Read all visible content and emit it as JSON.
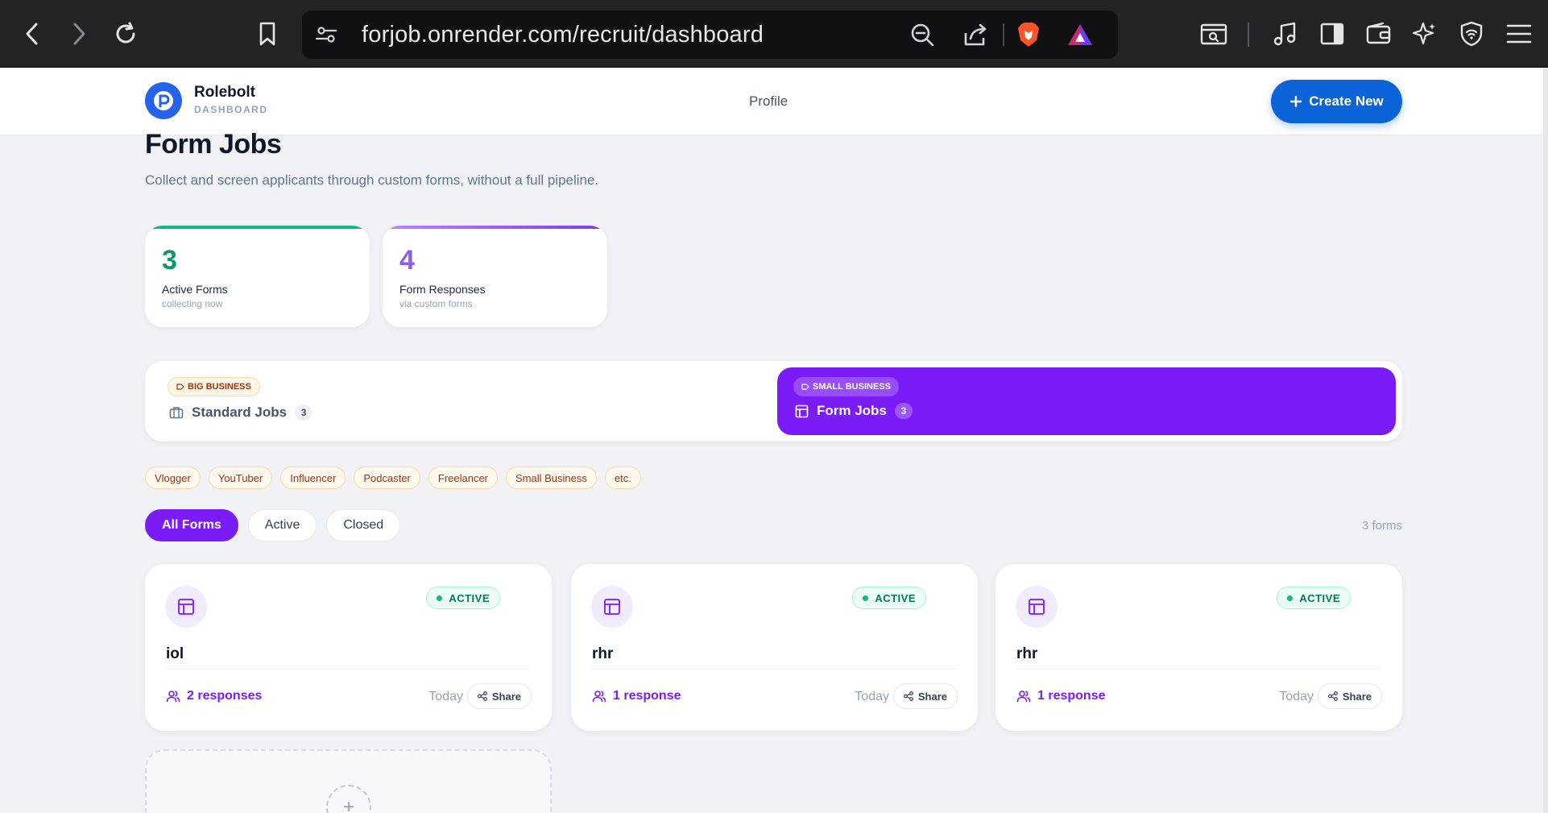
{
  "browser": {
    "url": "forjob.onrender.com/recruit/dashboard"
  },
  "header": {
    "brand_name": "Rolebolt",
    "brand_sub": "DASHBOARD",
    "nav_profile": "Profile",
    "create_label": "Create New"
  },
  "page": {
    "title": "Form Jobs",
    "subtitle": "Collect and screen applicants through custom forms, without a full pipeline."
  },
  "stats": [
    {
      "value": "3",
      "label": "Active Forms",
      "sub": "collecting now",
      "color": "#10976b",
      "bar": "#10b981"
    },
    {
      "value": "4",
      "label": "Form Responses",
      "sub": "via custom forms",
      "color": "#8b5cf6",
      "bar": "#a855f7"
    }
  ],
  "segments": {
    "standard": {
      "tag": "BIG BUSINESS",
      "title": "Standard Jobs",
      "count": "3"
    },
    "form": {
      "tag": "SMALL BUSINESS",
      "title": "Form Jobs",
      "count": "3"
    }
  },
  "tags": [
    "Vlogger",
    "YouTuber",
    "Influencer",
    "Podcaster",
    "Freelancer",
    "Small Business",
    "etc."
  ],
  "filters": {
    "all": "All Forms",
    "active": "Active",
    "closed": "Closed",
    "count_text": "3 forms"
  },
  "forms": [
    {
      "name": "iol",
      "status": "ACTIVE",
      "responses": "2 responses",
      "date": "Today",
      "share": "Share"
    },
    {
      "name": "rhr",
      "status": "ACTIVE",
      "responses": "1 response",
      "date": "Today",
      "share": "Share"
    },
    {
      "name": "rhr",
      "status": "ACTIVE",
      "responses": "1 response",
      "date": "Today",
      "share": "Share"
    }
  ],
  "colors": {
    "accent": "#7a1cf8",
    "primary": "#0b63d8",
    "success": "#10b981"
  }
}
